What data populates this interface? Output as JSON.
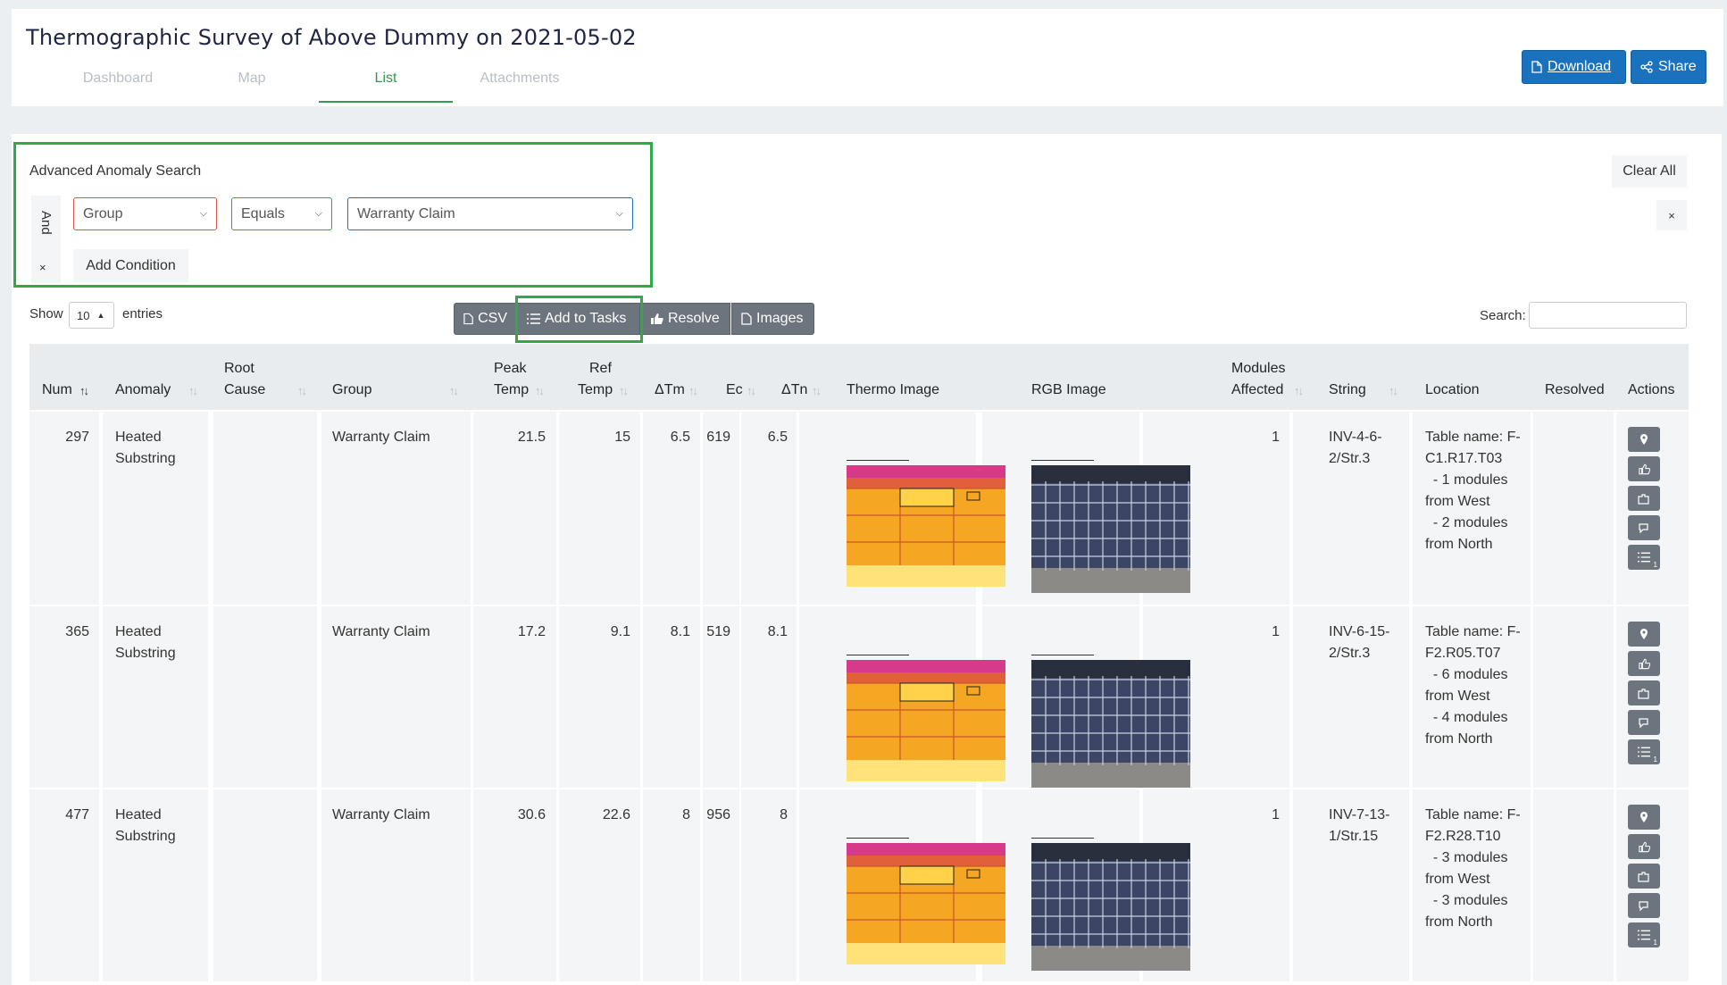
{
  "header": {
    "title": "Thermographic Survey of Above Dummy on 2021-05-02",
    "tabs": [
      "Dashboard",
      "Map",
      "List",
      "Attachments"
    ],
    "active_tab": "List",
    "download_label": "Download",
    "share_label": "Share"
  },
  "search_builder": {
    "title": "Advanced Anomaly Search",
    "logic": "And",
    "remove_glyph": "×",
    "condition": {
      "field": "Group",
      "operator": "Equals",
      "value": "Warranty Claim"
    },
    "add_condition_label": "Add Condition",
    "clear_all_label": "Clear All",
    "close_glyph": "×"
  },
  "table_controls": {
    "show_label": "Show",
    "page_size": "10",
    "entries_label": "entries",
    "buttons": [
      "CSV",
      "Add to Tasks",
      "Resolve",
      "Images"
    ],
    "search_label": "Search:",
    "search_value": ""
  },
  "columns": {
    "num": "Num",
    "anomaly": "Anomaly",
    "root1": "Root",
    "root2": "Cause",
    "group": "Group",
    "peak1": "Peak",
    "peak2": "Temp",
    "ref1": "Ref",
    "ref2": "Temp",
    "dtm": "ΔTm",
    "ec": "Ec",
    "dtn": "ΔTn",
    "thermo": "Thermo Image",
    "rgb": "RGB Image",
    "mod1": "Modules",
    "mod2": "Affected",
    "string": "String",
    "location": "Location",
    "resolved": "Resolved",
    "actions": "Actions"
  },
  "rows": [
    {
      "num": "297",
      "anomaly1": "Heated",
      "anomaly2": "Substring",
      "group": "Warranty Claim",
      "peak": "21.5",
      "ref": "15",
      "dtm": "6.5",
      "ec": "619",
      "dtn": "6.5",
      "modules": "1",
      "string1": "INV-4-6-",
      "string2": "2/Str.3",
      "loc": [
        "Table name: F-",
        "C1.R17.T03",
        "  - 1 modules",
        "from West",
        "  - 2 modules",
        "from North"
      ],
      "tasks_count": "1"
    },
    {
      "num": "365",
      "anomaly1": "Heated",
      "anomaly2": "Substring",
      "group": "Warranty Claim",
      "peak": "17.2",
      "ref": "9.1",
      "dtm": "8.1",
      "ec": "519",
      "dtn": "8.1",
      "modules": "1",
      "string1": "INV-6-15-",
      "string2": "2/Str.3",
      "loc": [
        "Table name: F-",
        "F2.R05.T07",
        "  - 6 modules",
        "from West",
        "  - 4 modules",
        "from North"
      ],
      "tasks_count": "1"
    },
    {
      "num": "477",
      "anomaly1": "Heated",
      "anomaly2": "Substring",
      "group": "Warranty Claim",
      "peak": "30.6",
      "ref": "22.6",
      "dtm": "8",
      "ec": "956",
      "dtn": "8",
      "modules": "1",
      "string1": "INV-7-13-",
      "string2": "1/Str.15",
      "loc": [
        "Table name: F-",
        "F2.R28.T10",
        "  - 3 modules",
        "from West",
        "  - 3 modules",
        "from North"
      ],
      "tasks_count": "1"
    }
  ],
  "colors": {
    "accent_green": "#2e9a52",
    "highlight_green": "#2eaa4a",
    "primary_blue": "#1a72bf",
    "button_gray": "#6c757d"
  }
}
